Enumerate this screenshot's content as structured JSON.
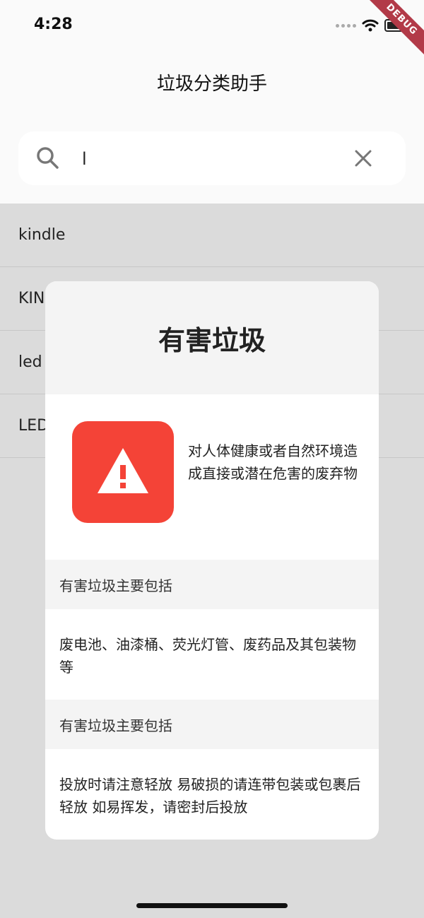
{
  "status_bar": {
    "time": "4:28",
    "debug_label": "DEBUG"
  },
  "app": {
    "title": "垃圾分类助手"
  },
  "search": {
    "value": "l",
    "placeholder": ""
  },
  "results": [
    {
      "label": "kindle"
    },
    {
      "label": "KINDLE"
    },
    {
      "label": "led"
    },
    {
      "label": "LED"
    }
  ],
  "dialog": {
    "title": "有害垃圾",
    "icon_color": "#f44337",
    "icon": "warning-icon",
    "description": "对人体健康或者自然环境造成直接或潜在危害的废弃物",
    "sections": [
      {
        "heading": "有害垃圾主要包括",
        "content": "废电池、油漆桶、荧光灯管、废药品及其包装物等"
      },
      {
        "heading": "有害垃圾主要包括",
        "content": "投放时请注意轻放 易破损的请连带包装或包裹后轻放 如易挥发，请密封后投放"
      }
    ]
  }
}
